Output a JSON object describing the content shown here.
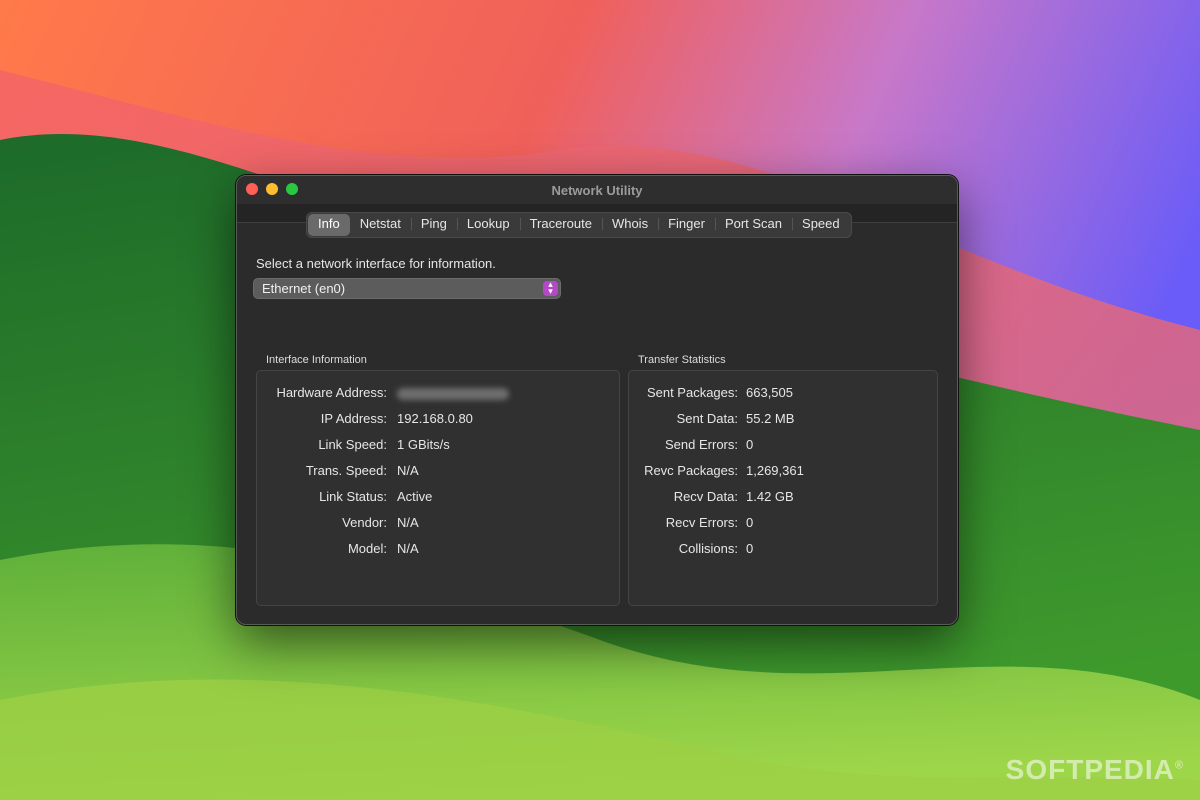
{
  "window": {
    "title": "Network Utility"
  },
  "tabs": [
    {
      "label": "Info",
      "active": true
    },
    {
      "label": "Netstat"
    },
    {
      "label": "Ping"
    },
    {
      "label": "Lookup"
    },
    {
      "label": "Traceroute"
    },
    {
      "label": "Whois"
    },
    {
      "label": "Finger"
    },
    {
      "label": "Port Scan"
    },
    {
      "label": "Speed"
    }
  ],
  "info": {
    "prompt": "Select a network interface for information.",
    "selected_interface": "Ethernet (en0)"
  },
  "interface_information": {
    "title": "Interface Information",
    "rows": [
      {
        "label": "Hardware Address:",
        "value": "",
        "blurred": true
      },
      {
        "label": "IP Address:",
        "value": "192.168.0.80"
      },
      {
        "label": "Link Speed:",
        "value": "1 GBits/s"
      },
      {
        "label": "Trans. Speed:",
        "value": "N/A"
      },
      {
        "label": "Link Status:",
        "value": "Active"
      },
      {
        "label": "Vendor:",
        "value": "N/A"
      },
      {
        "label": "Model:",
        "value": "N/A"
      }
    ]
  },
  "transfer_statistics": {
    "title": "Transfer Statistics",
    "rows": [
      {
        "label": "Sent Packages:",
        "value": "663,505"
      },
      {
        "label": "Sent Data:",
        "value": "55.2 MB"
      },
      {
        "label": "Send Errors:",
        "value": "0"
      },
      {
        "label": "Revc Packages:",
        "value": "1,269,361"
      },
      {
        "label": "Recv Data:",
        "value": "1.42 GB"
      },
      {
        "label": "Recv Errors:",
        "value": "0"
      },
      {
        "label": "Collisions:",
        "value": "0"
      }
    ]
  },
  "watermark": "SOFTPEDIA",
  "colors": {
    "accent": "#b548c6",
    "close": "#fe5f57",
    "minimize": "#febc2e",
    "maximize": "#28c840"
  }
}
